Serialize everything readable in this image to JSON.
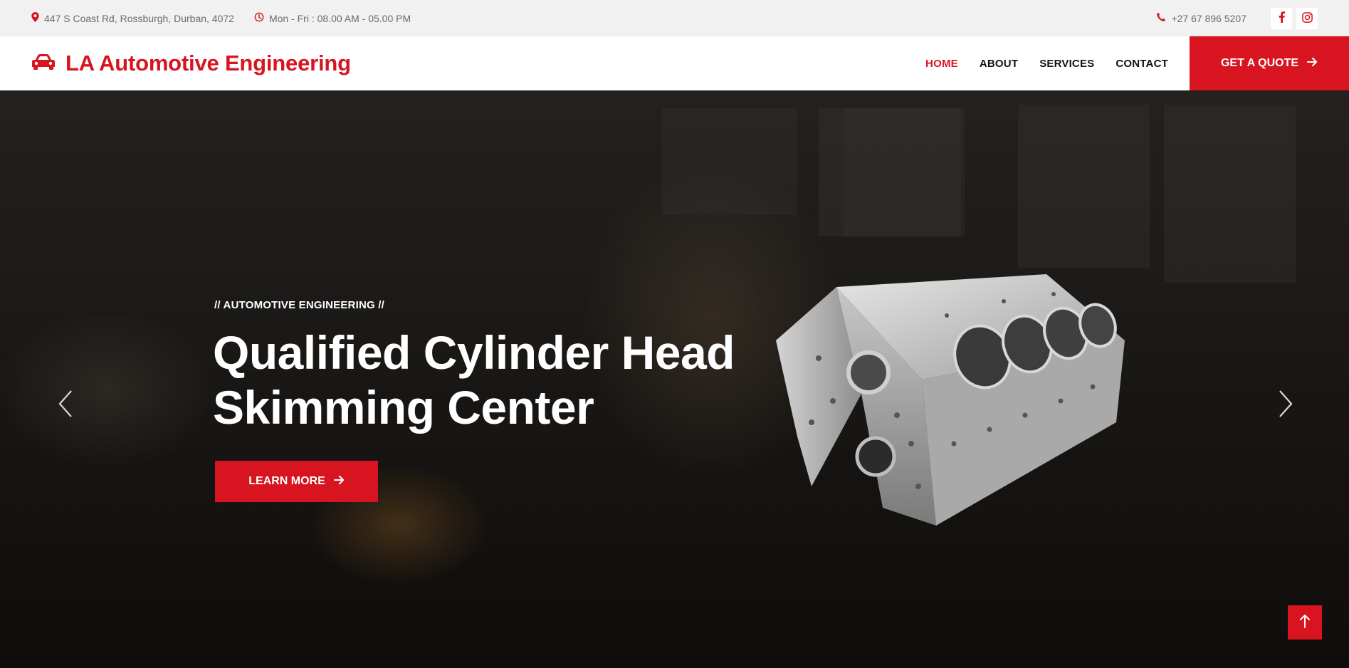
{
  "topbar": {
    "address": "447 S Coast Rd, Rossburgh, Durban, 4072",
    "hours": "Mon - Fri : 08.00 AM - 05.00 PM",
    "phone": "+27 67 896 5207",
    "icons": [
      "location-pin-icon",
      "clock-icon",
      "phone-icon",
      "facebook-icon",
      "instagram-icon"
    ]
  },
  "header": {
    "brand": "LA Automotive Engineering",
    "brand_icon": "car-icon",
    "nav": [
      {
        "label": "HOME",
        "active": true
      },
      {
        "label": "ABOUT",
        "active": false
      },
      {
        "label": "SERVICES",
        "active": false
      },
      {
        "label": "CONTACT",
        "active": false
      }
    ],
    "cta": "GET A QUOTE"
  },
  "hero": {
    "kicker": "// AUTOMOTIVE ENGINEERING //",
    "headline_line1": "Qualified Cylinder Head",
    "headline_line2": "Skimming Center",
    "button": "LEARN MORE"
  },
  "colors": {
    "accent": "#d7141f",
    "topbar_bg": "#f1f1f1",
    "text_dark": "#111111"
  }
}
